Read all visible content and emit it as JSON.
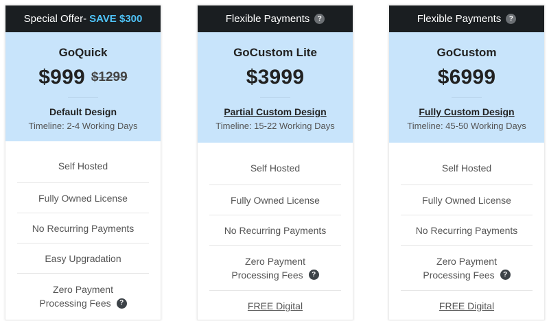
{
  "plans": [
    {
      "header_prefix": "Special Offer-",
      "header_highlight": "SAVE $300",
      "name": "GoQuick",
      "price": "$999",
      "old_price": "$1299",
      "design": "Default Design",
      "timeline": "Timeline: 2-4 Working Days",
      "features": [
        "Self Hosted",
        "Fully Owned License",
        "No Recurring Payments",
        "Easy Upgradation",
        "Zero Payment",
        "Processing Fees"
      ]
    },
    {
      "header": "Flexible Payments",
      "name": "GoCustom Lite",
      "price": "$3999",
      "design": "Partial Custom Design",
      "timeline": "Timeline: 15-22 Working Days",
      "features": [
        "Self Hosted",
        "Fully Owned License",
        "No Recurring Payments",
        "Zero Payment",
        "Processing Fees",
        "FREE Digital"
      ]
    },
    {
      "header": "Flexible Payments",
      "name": "GoCustom",
      "price": "$6999",
      "design": "Fully Custom Design",
      "timeline": "Timeline: 45-50 Working Days",
      "features": [
        "Self Hosted",
        "Fully Owned License",
        "No Recurring Payments",
        "Zero Payment",
        "Processing Fees",
        "FREE Digital"
      ]
    }
  ],
  "help_glyph": "?",
  "colors": {
    "header_bg": "#1a1e21",
    "highlight": "#4fc3f7",
    "top_bg": "#c8e4fb"
  },
  "icons": {
    "help": "question-mark-circle-icon"
  }
}
